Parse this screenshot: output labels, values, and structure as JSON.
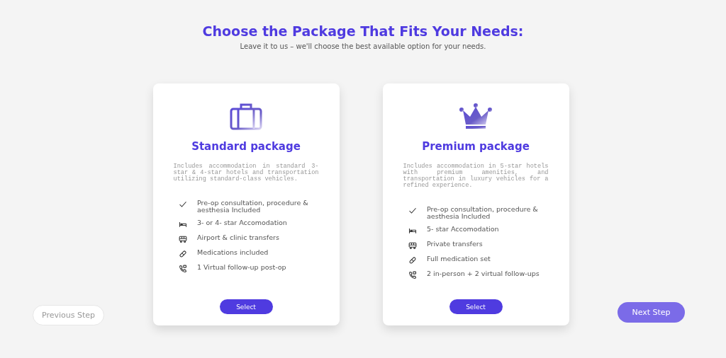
{
  "header": {
    "title": "Choose the Package That Fits Your Needs:",
    "subtitle": "Leave it to us – we'll choose the best available option for your needs."
  },
  "packages": [
    {
      "kind": "suitcase",
      "title": "Standard package",
      "description": "Includes accommodation in standard 3-star & 4-star hotels and transportation utilizing standard-class vehicles.",
      "features": [
        {
          "kind": "check",
          "text": "Pre-op consultation, procedure & aesthesia Included"
        },
        {
          "kind": "bed",
          "text": "3- or 4- star Accomodation"
        },
        {
          "kind": "bus",
          "text": "Airport & clinic transfers"
        },
        {
          "kind": "pill",
          "text": "Medications included"
        },
        {
          "kind": "phone",
          "text": "1 Virtual follow-up post-op"
        }
      ],
      "button": "Select"
    },
    {
      "kind": "crown",
      "title": "Premium package",
      "description": "Includes accommodation in 5-star hotels with premium amenities, and transportation in luxury vehicles for a refined experience.",
      "features": [
        {
          "kind": "check",
          "text": "Pre-op consultation, procedure & aesthesia Included"
        },
        {
          "kind": "bed",
          "text": "5- star Accomodation"
        },
        {
          "kind": "bus",
          "text": "Private transfers"
        },
        {
          "kind": "pill",
          "text": "Full medication set"
        },
        {
          "kind": "phone",
          "text": "2 in-person + 2 virtual follow-ups"
        }
      ],
      "button": "Select"
    }
  ],
  "navigation": {
    "previous": "Previous Step",
    "next": "Next Step"
  }
}
